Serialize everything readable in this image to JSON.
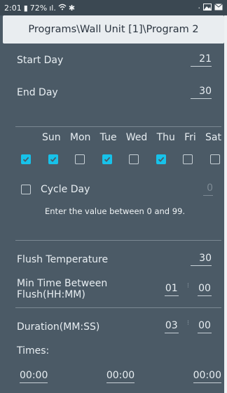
{
  "status_bar": {
    "time": "2:01",
    "battery_percent": "72%",
    "signal_icon": "signal-icon",
    "wifi_icon": "wifi-icon",
    "bluetooth_icon": "bluetooth-icon",
    "right_icons": [
      "dot-icon",
      "image-icon",
      "mail-icon"
    ]
  },
  "title": "Programs\\Wall Unit [1]\\Program 2",
  "start_day": {
    "label": "Start Day",
    "value": "21"
  },
  "end_day": {
    "label": "End Day",
    "value": "30"
  },
  "days": {
    "labels": [
      "Sun",
      "Mon",
      "Tue",
      "Wed",
      "Thu",
      "Fri",
      "Sat"
    ],
    "checks": [
      true,
      true,
      false,
      true,
      false,
      true,
      false,
      false
    ]
  },
  "cycle_day": {
    "label": "Cycle Day",
    "value": "0",
    "checked": false
  },
  "hint": "Enter the value between 0 and 99.",
  "flush_temperature": {
    "label": "Flush Temperature",
    "value": "30"
  },
  "min_time": {
    "label_line1": "Min Time Between",
    "label_line2": "Flush(HH:MM)",
    "hours": "01",
    "minutes": "00"
  },
  "duration": {
    "label": "Duration(MM:SS)",
    "minutes": "03",
    "seconds": "00"
  },
  "times": {
    "label": "Times:",
    "values": [
      "00:00",
      "00:00",
      "00:00"
    ]
  },
  "colors": {
    "accent": "#17c2ea",
    "background": "#4b5a66",
    "title_bar": "#e9edf0"
  }
}
